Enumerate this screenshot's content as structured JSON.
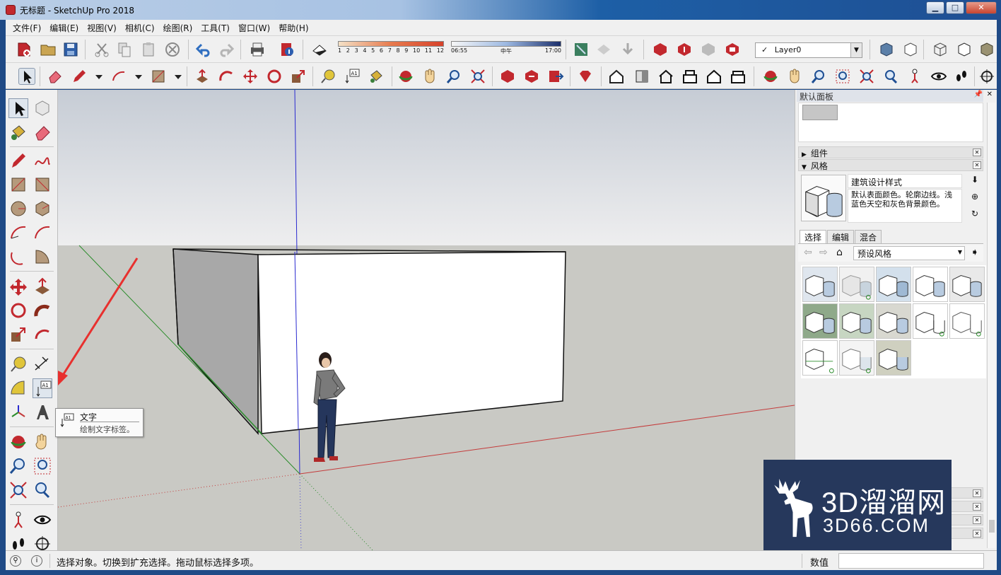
{
  "window": {
    "title": "无标题 - SketchUp Pro 2018",
    "buttons": {
      "minimize": "▁",
      "maximize": "□",
      "close": "✕"
    }
  },
  "menu": [
    "文件(F)",
    "编辑(E)",
    "视图(V)",
    "相机(C)",
    "绘图(R)",
    "工具(T)",
    "窗口(W)",
    "帮助(H)"
  ],
  "shadow": {
    "month_ticks": [
      "1",
      "2",
      "3",
      "4",
      "5",
      "6",
      "7",
      "8",
      "9",
      "10",
      "11",
      "12"
    ],
    "time_start": "06:55",
    "time_mid": "中午",
    "time_end": "17:00"
  },
  "layer": {
    "current": "Layer0",
    "check": "✓"
  },
  "tooltip": {
    "title": "文字",
    "description": "绘制文字标签。",
    "icon_label": "A1"
  },
  "tray": {
    "title": "默认面板",
    "panels": {
      "components": "组件",
      "styles": "风格"
    },
    "style": {
      "name": "建筑设计样式",
      "description": "默认表面颜色。轮廓边线。浅蓝色天空和灰色背景颜色。"
    },
    "tabs": [
      "选择",
      "编辑",
      "混合"
    ],
    "preset": "预设风格"
  },
  "watermark": {
    "main": "3D溜溜网",
    "url": "3D66.COM"
  },
  "status": {
    "hint": "选择对象。切换到扩充选择。拖动鼠标选择多项。",
    "measure_label": "数值",
    "measure_value": ""
  },
  "colors": {
    "accent_red": "#e8302e",
    "axis_red": "#c43c3c",
    "axis_green": "#2a8c2a",
    "axis_blue": "#2a2ad0",
    "sky_top": "#c9d0da",
    "ground": "#c9c9c4",
    "watermark_bg": "#26385c"
  }
}
